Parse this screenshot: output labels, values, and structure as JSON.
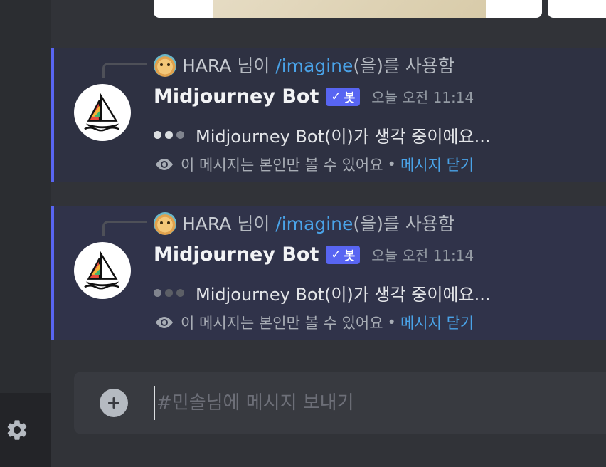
{
  "colors": {
    "accent": "#5865f2",
    "link": "#4aa3e8",
    "background": "#313338",
    "message_highlight": "#2e3142"
  },
  "messages": [
    {
      "reply": {
        "user": "HARA",
        "suffix_a": " 님이 ",
        "command": "/imagine",
        "suffix_b": "(을)를 사용함",
        "avatar_icon": "hamster-avatar-icon"
      },
      "author": "Midjourney Bot",
      "bot_tag": "봇",
      "timestamp": "오늘 오전 11:14",
      "text": "Midjourney Bot(이)가 생각 중이에요...",
      "ephemeral_notice": "이 메시지는 본인만 볼 수 있어요",
      "separator": "•",
      "dismiss_label": "메시지 닫기"
    },
    {
      "reply": {
        "user": "HARA",
        "suffix_a": " 님이 ",
        "command": "/imagine",
        "suffix_b": "(을)를 사용함",
        "avatar_icon": "hamster-avatar-icon"
      },
      "author": "Midjourney Bot",
      "bot_tag": "봇",
      "timestamp": "오늘 오전 11:14",
      "text": "Midjourney Bot(이)가 생각 중이에요...",
      "ephemeral_notice": "이 메시지는 본인만 볼 수 있어요",
      "separator": "•",
      "dismiss_label": "메시지 닫기"
    }
  ],
  "composer": {
    "placeholder": "#민솔님에 메시지 보내기",
    "add_icon": "plus-circle-icon"
  },
  "sidebar": {
    "settings_icon": "gear-icon"
  }
}
